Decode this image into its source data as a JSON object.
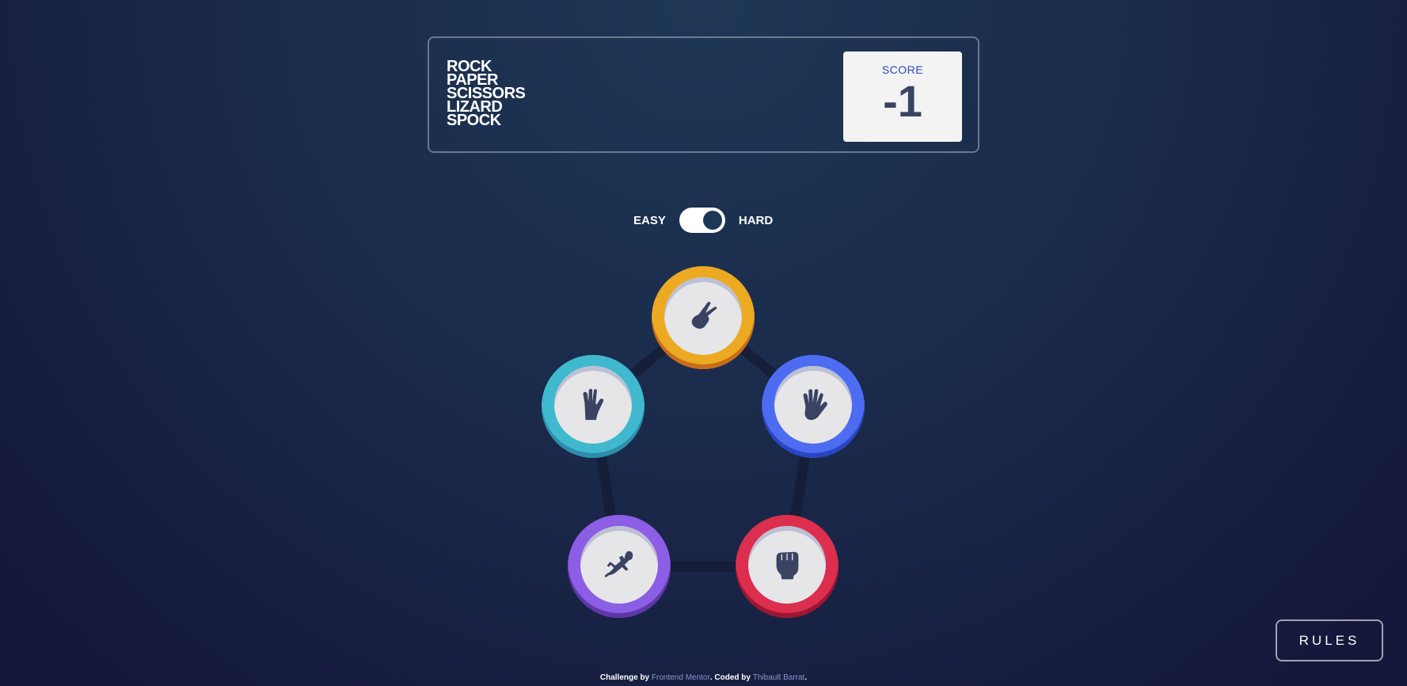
{
  "header": {
    "logo_lines": [
      "ROCK",
      "PAPER",
      "SCISSORS",
      "LIZARD",
      "SPOCK"
    ],
    "score_label": "SCORE",
    "score_value": "-1"
  },
  "difficulty": {
    "easy_label": "EASY",
    "hard_label": "HARD",
    "selected": "HARD"
  },
  "choices": [
    {
      "name": "scissors",
      "icon": "scissors-icon",
      "ring_color": "#eca922"
    },
    {
      "name": "paper",
      "icon": "paper-icon",
      "ring_color": "#4d6cf1"
    },
    {
      "name": "rock",
      "icon": "rock-icon",
      "ring_color": "#dc2e4e"
    },
    {
      "name": "lizard",
      "icon": "lizard-icon",
      "ring_color": "#8c5de5"
    },
    {
      "name": "spock",
      "icon": "spock-icon",
      "ring_color": "#40b9ce"
    }
  ],
  "rules_button": {
    "label": "RULES"
  },
  "attribution": {
    "prefix": "Challenge by ",
    "challenge_link": "Frontend Mentor",
    "middle": ". Coded by ",
    "author_link": "Thibault Barrat",
    "suffix": "."
  },
  "colors": {
    "score_label": "#2a46c0",
    "dark_text": "#3b4363",
    "background_top": "#1f3756",
    "background_bottom": "#141539"
  }
}
